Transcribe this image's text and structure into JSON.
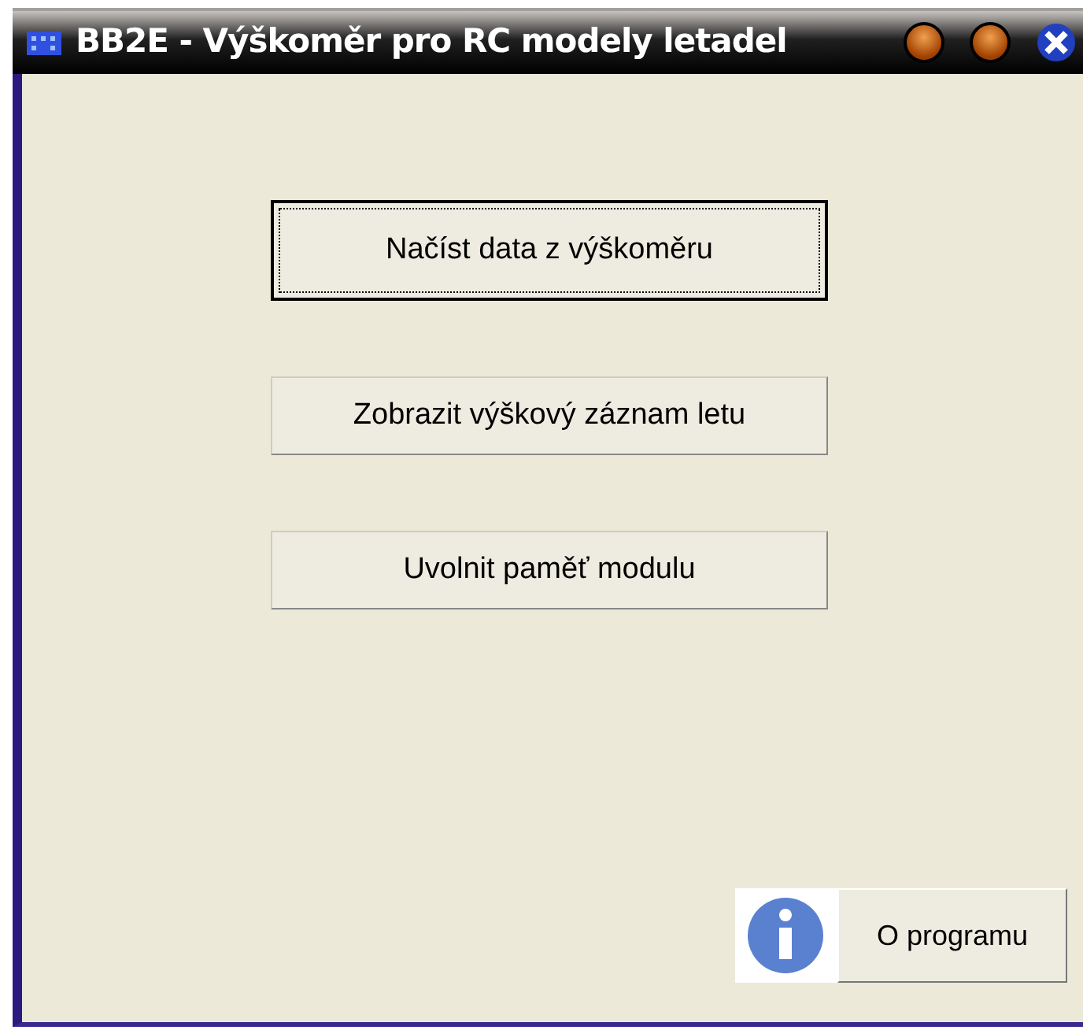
{
  "window": {
    "title": "BB2E - Výškoměr pro RC modely letadel"
  },
  "buttons": [
    {
      "label": "Načíst data z výškoměru",
      "focused": true
    },
    {
      "label": "Zobrazit výškový záznam letu",
      "focused": false
    },
    {
      "label": "Uvolnit paměť modulu",
      "focused": false
    }
  ],
  "about_button": {
    "label": "O programu"
  }
}
